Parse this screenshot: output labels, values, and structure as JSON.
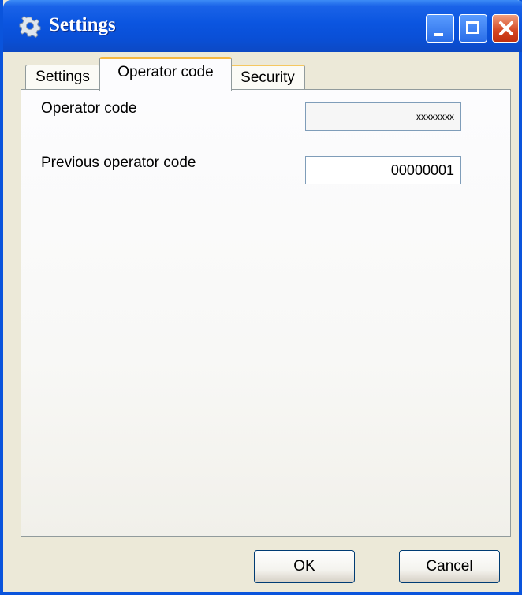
{
  "window": {
    "title": "Settings",
    "icon": "gear-icon",
    "controls": [
      "minimize-icon",
      "maximize-icon",
      "close-icon"
    ]
  },
  "tabs": [
    {
      "label": "Settings",
      "selected": false
    },
    {
      "label": "Operator code",
      "selected": true
    },
    {
      "label": "Security",
      "selected": false
    }
  ],
  "form": {
    "operator_code": {
      "label": "Operator code",
      "value": "xxxxxxxx"
    },
    "previous_operator_code": {
      "label": "Previous operator code",
      "value": "00000001"
    }
  },
  "buttons": {
    "ok": "OK",
    "cancel": "Cancel"
  },
  "colors": {
    "titlebar": "#0a54dc",
    "tab_highlight": "#f5b842",
    "window_bg": "#ece9d8"
  }
}
